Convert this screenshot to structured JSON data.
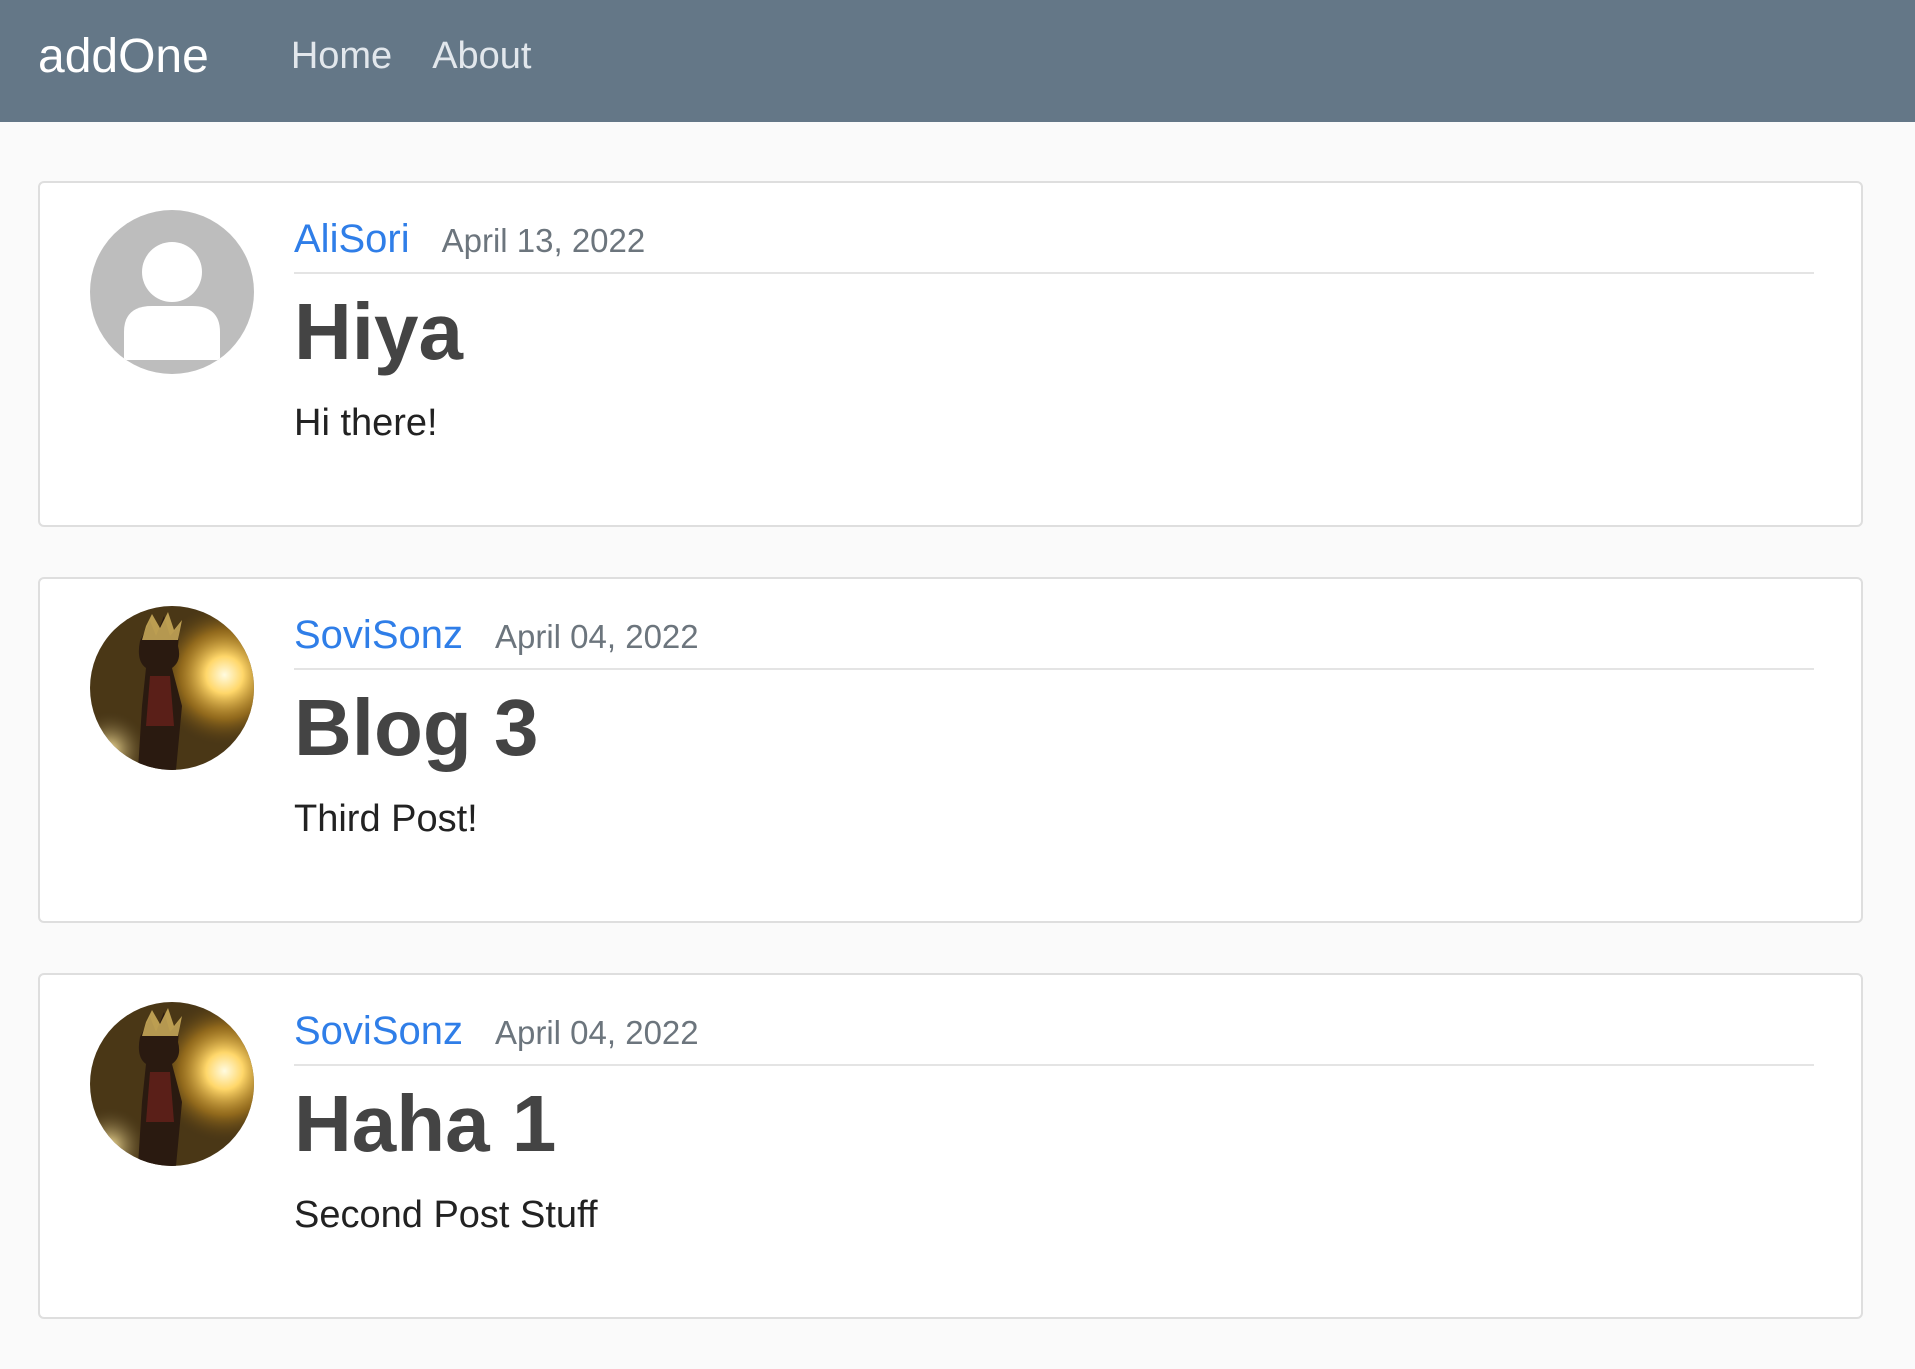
{
  "navbar": {
    "brand": "addOne",
    "links": [
      "Home",
      "About"
    ]
  },
  "posts": [
    {
      "author": "AliSori",
      "date": "April 13, 2022",
      "title": "Hiya",
      "content": "Hi there!",
      "avatar": "default-user-icon"
    },
    {
      "author": "SoviSonz",
      "date": "April 04, 2022",
      "title": "Blog 3",
      "content": "Third Post!",
      "avatar": "profile-photo"
    },
    {
      "author": "SoviSonz",
      "date": "April 04, 2022",
      "title": "Haha 1",
      "content": "Second Post Stuff",
      "avatar": "profile-photo"
    }
  ],
  "colors": {
    "navbar_bg": "#647787",
    "link_blue": "#2f7ee8",
    "page_bg": "#fafafa"
  }
}
